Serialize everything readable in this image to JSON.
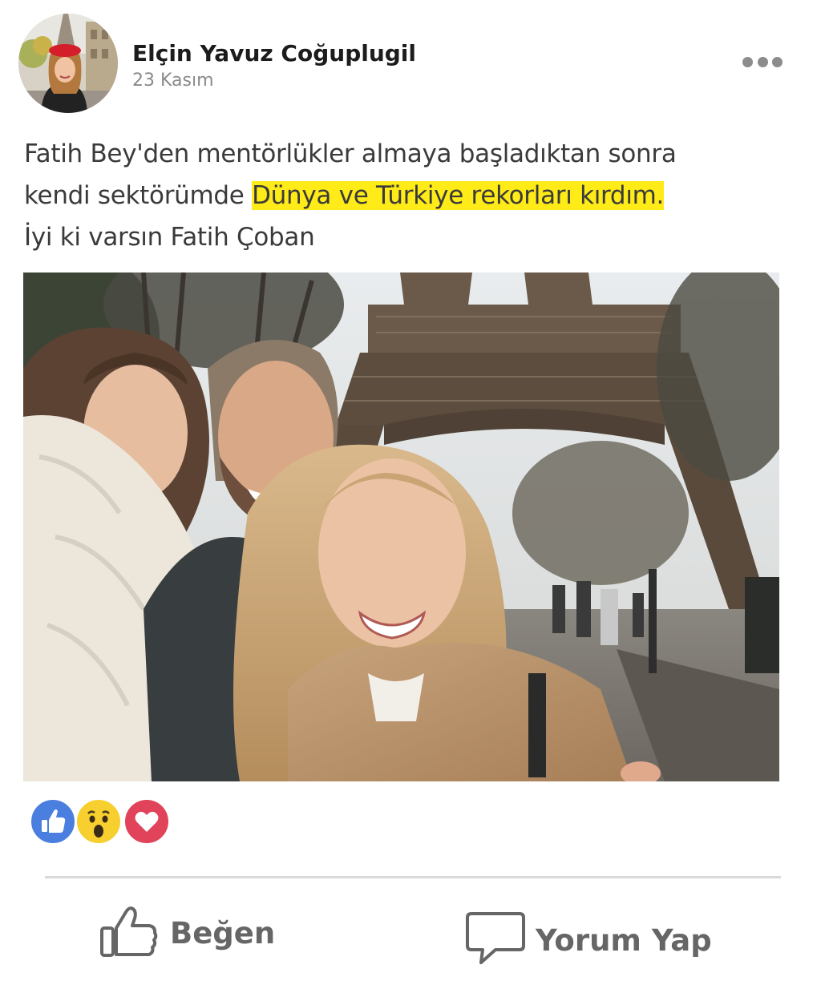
{
  "post": {
    "author": "Elçin Yavuz Coğuplugil",
    "date": "23 Kasım",
    "text": {
      "line1": "Fatih Bey'den mentörlükler almaya başladıktan sonra",
      "line2_prefix": "kendi sektörümde ",
      "line2_highlight": "Dünya ve Türkiye rekorları kırdım.",
      "line3": "İyi ki varsın Fatih Çoban"
    }
  },
  "reactions": [
    "like-icon",
    "wow-icon",
    "love-icon"
  ],
  "actions": {
    "like_label": "Beğen",
    "comment_label": "Yorum Yap"
  },
  "colors": {
    "highlight": "#ffeb17",
    "like": "#4a7fe0",
    "wow": "#f7cf2e",
    "love": "#e0435a",
    "action_text": "#666666"
  }
}
